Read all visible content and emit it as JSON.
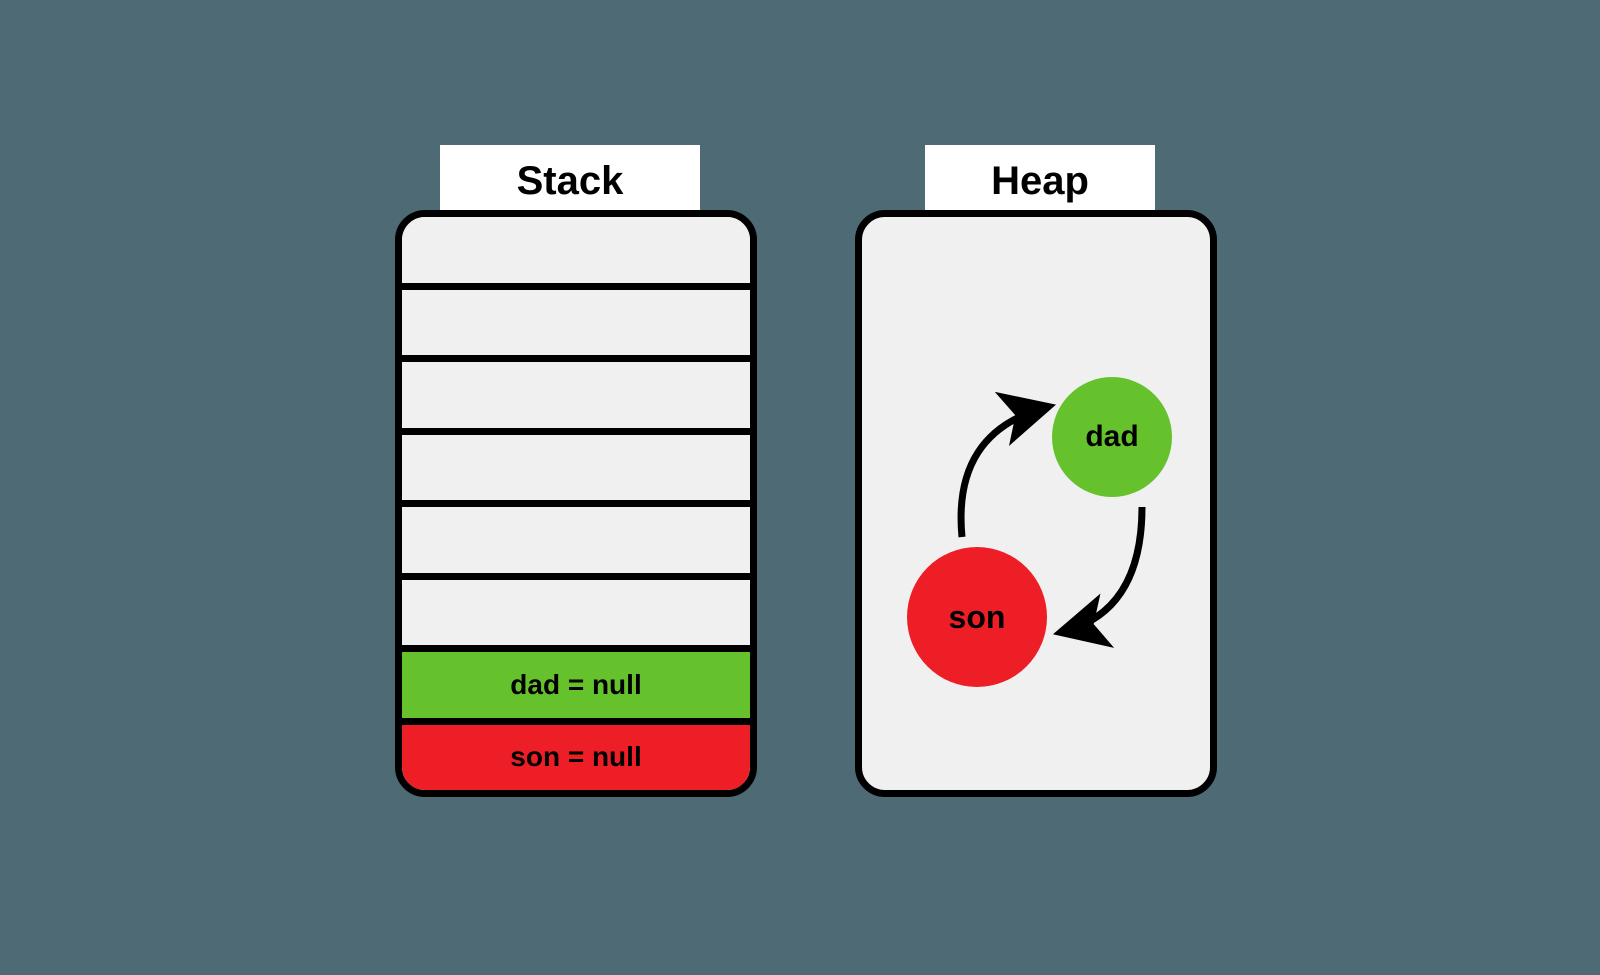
{
  "stack": {
    "title": "Stack",
    "rows": [
      {
        "label": "",
        "color": "empty"
      },
      {
        "label": "",
        "color": "empty"
      },
      {
        "label": "",
        "color": "empty"
      },
      {
        "label": "",
        "color": "empty"
      },
      {
        "label": "",
        "color": "empty"
      },
      {
        "label": "",
        "color": "empty"
      },
      {
        "label": "dad = null",
        "color": "green"
      },
      {
        "label": "son = null",
        "color": "red"
      }
    ]
  },
  "heap": {
    "title": "Heap",
    "nodes": {
      "dad": {
        "label": "dad",
        "color": "green"
      },
      "son": {
        "label": "son",
        "color": "red"
      }
    },
    "arrows": [
      {
        "from": "son",
        "to": "dad"
      },
      {
        "from": "dad",
        "to": "son"
      }
    ]
  },
  "colors": {
    "background": "#4e6b75",
    "panel": "#f0f0f0",
    "border": "#000000",
    "green": "#66c22c",
    "red": "#ed1e26",
    "white": "#ffffff"
  }
}
